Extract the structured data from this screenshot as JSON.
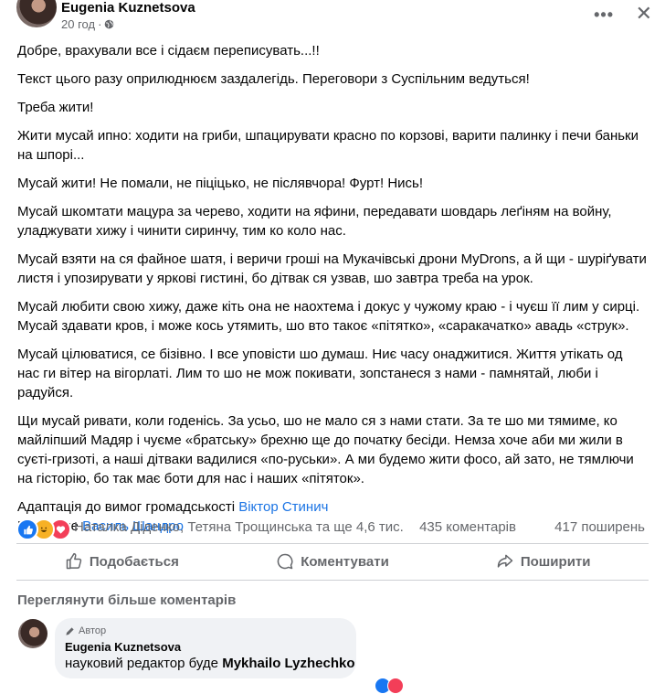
{
  "post": {
    "author": "Eugenia Kuznetsova",
    "time": "20 год",
    "paragraphs": [
      "Добре, врахували все і сідаєм переписувать...!!",
      "Текст цього разу оприлюднюєм заздалегідь. Переговори з Суспільним ведуться!",
      "Треба жити!",
      "Жити мусай ипно: ходити на гриби, шпацирувати красно по корзові, варити палинку і печи баньки на шпорі...",
      "Мусай жити! Не помали, не піцiцько, не післявчора! Фурт! Нись!",
      "Мусай шкомтати мацура за черево, ходити на яфини, передавати шовдарь леґіням на войну, уладжувати хижу і чинити сиринчу, тим ко коло нас.",
      "Мусай взяти на ся файное шатя, і веричи гроші на Мукачівські дрони MyDrons, а й щи - шуріґувати листя і упозирувати у яркові гистині, бо дітвак ся узвав, шо завтра треба на урок.",
      "Мусай любити свою хижу, даже кіть она не наохтема і докус у чужому краю - і чуєш її лим у сирці. Мусай здавати кров, і може кось утямить, шо вто такоє «пітятко», «саракачатко» авадь «струк».",
      "Мусай цілюватися, се бізівно. І все уповісти шо думаш. Ниє часу онаджитися. Життя утікать од нас ги вітер на вігорлаті. Лим то шо не мож покивати, зопстанеся з нами - памнятай, люби і радуйся.",
      "Щи мусай ривати, коли годенісь. За усьо, шо не мало ся з нами стати. За те шо ми тямиме, ко майліпший Мадяр і чуєме «братську» брехню ще до початку бесіди. Немза хоче аби ми жили в суєті-гризоті, а наші дітваки вадилися «по-руськи». А ми будемо жити фосо, ай зато, не тямлючи на гісторію, бо так має боти для нас і наших «пітяток»."
    ],
    "credit_adapt_label": "Адаптація до вимог громадськості",
    "credit_adapt_name": "Віктор Стинич",
    "credit_read_label": "Читатиме",
    "credit_read_name": "Василь Шандро"
  },
  "reactions": {
    "names": "Наталка Діденко, Тетяна Трощинська та ще 4,6 тис.",
    "comments": "435 коментарів",
    "shares": "417 поширень"
  },
  "actions": {
    "like": "Подобається",
    "comment": "Коментувати",
    "share": "Поширити"
  },
  "more_comments": "Переглянути більше коментарів",
  "comment": {
    "badge": "Автор",
    "author": "Eugenia Kuznetsova",
    "text_prefix": "науковий редактор буде",
    "text_name": "Mykhailo Lyzhechko"
  },
  "colors": {
    "link": "#1b74e4",
    "like": "#1877f2",
    "haha": "#f7b125",
    "love": "#f33e58"
  },
  "icons": [
    "globe-icon",
    "more-icon",
    "close-icon",
    "like-icon",
    "comment-icon",
    "share-icon",
    "pencil-icon"
  ]
}
